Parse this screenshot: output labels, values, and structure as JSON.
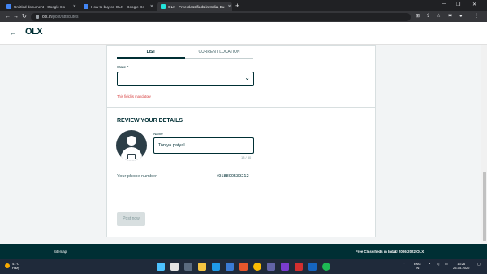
{
  "browser": {
    "tabs": [
      {
        "title": "Untitled document - Google Do",
        "favicon_color": "#4285f4",
        "active": false
      },
      {
        "title": "How to buy on OLX - Google Do",
        "favicon_color": "#4285f4",
        "active": false
      },
      {
        "title": "OLX - Free classifieds in India, Bu",
        "favicon_color": "#23e5db",
        "active": true
      }
    ],
    "new_tab_label": "+",
    "url_host": "olx.in",
    "url_path": "/post/attributes"
  },
  "header": {
    "back_icon": "←",
    "logo_text": "OLX"
  },
  "location_tabs": {
    "list_label": "LIST",
    "current_location_label": "CURRENT LOCATION"
  },
  "state": {
    "label": "State *",
    "value": "",
    "error": "This field is mandatory"
  },
  "review": {
    "heading": "REVIEW YOUR DETAILS",
    "name_label": "Name",
    "name_value": "Toniya patyal",
    "name_counter": "13 / 30",
    "phone_label": "Your phone number",
    "phone_value": "+918800539212"
  },
  "post_button_label": "Post now",
  "footer": {
    "sitemap": "Sitemap",
    "free_ads": "Free Classifieds in India",
    "copyright": ". © 2006-2022 OLX"
  },
  "taskbar": {
    "temperature": "41°C",
    "weather_text": "Hazy",
    "language": "ENG",
    "region": "IN",
    "time": "13:26",
    "date": "25-05-2022"
  },
  "colors": {
    "brand": "#002f34",
    "error": "#d63c3c"
  }
}
